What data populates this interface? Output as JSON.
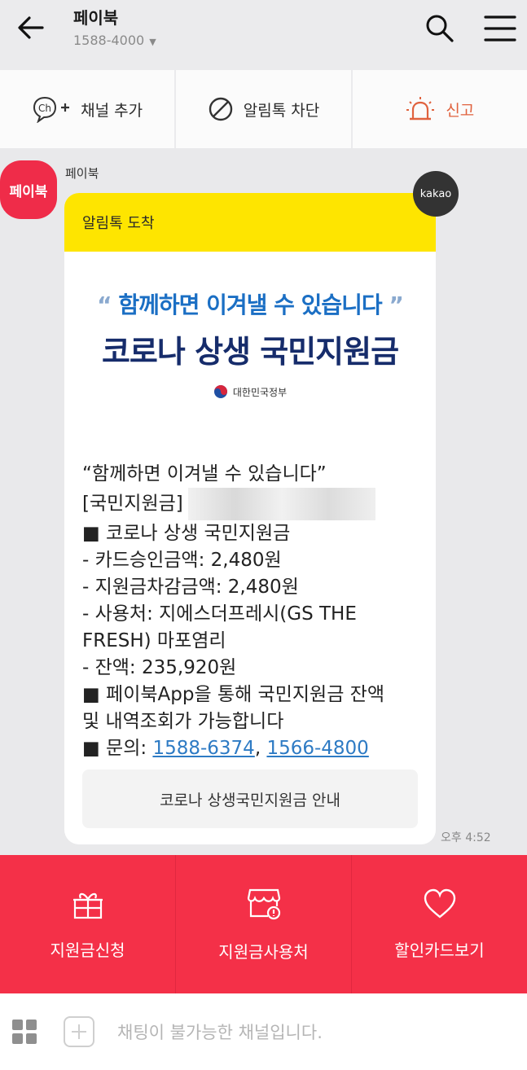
{
  "header": {
    "title": "페이북",
    "phone": "1588-4000"
  },
  "actions": {
    "add_channel": "채널 추가",
    "block": "알림톡 차단",
    "report": "신고"
  },
  "chat": {
    "avatar_label": "페이북",
    "sender": "페이북",
    "bubble_header": "알림톡 도착",
    "banner_quote": "함께하면 이겨낼 수 있습니다",
    "banner_open_quote": "“",
    "banner_close_quote": "”",
    "banner_main": "코로나 상생 국민지원금",
    "gov_label": "대한민국정부",
    "kakao_badge": "kakao",
    "message_lines": {
      "l1": "“함께하면 이겨낼 수 있습니다”",
      "l2": "[국민지원금]",
      "l3": "■ 코로나 상생 국민지원금",
      "l4": "- 카드승인금액: 2,480원",
      "l5": "- 지원금차감금액: 2,480원",
      "l6": "- 사용처: 지에스더프레시(GS THE",
      "l7": "FRESH) 마포염리",
      "l8": "- 잔액: 235,920원",
      "l9": "■ 페이북App을 통해 국민지원금 잔액",
      "l10": "및 내역조회가 가능합니다",
      "l11_prefix": "■ 문의: ",
      "phone1": "1588-6374",
      "separator": ", ",
      "phone2": "1566-4800"
    },
    "guide_button": "코로나 상생국민지원금 안내",
    "time": "오후 4:52"
  },
  "bottom_menu": {
    "apply": "지원금신청",
    "places": "지원금사용처",
    "cards": "할인카드보기"
  },
  "input": {
    "placeholder": "채팅이 불가능한 채널입니다."
  },
  "colors": {
    "brand_red": "#f43048",
    "kakao_yellow": "#fee500",
    "link_blue": "#2e7bc4",
    "report_orange": "#e0623e"
  }
}
